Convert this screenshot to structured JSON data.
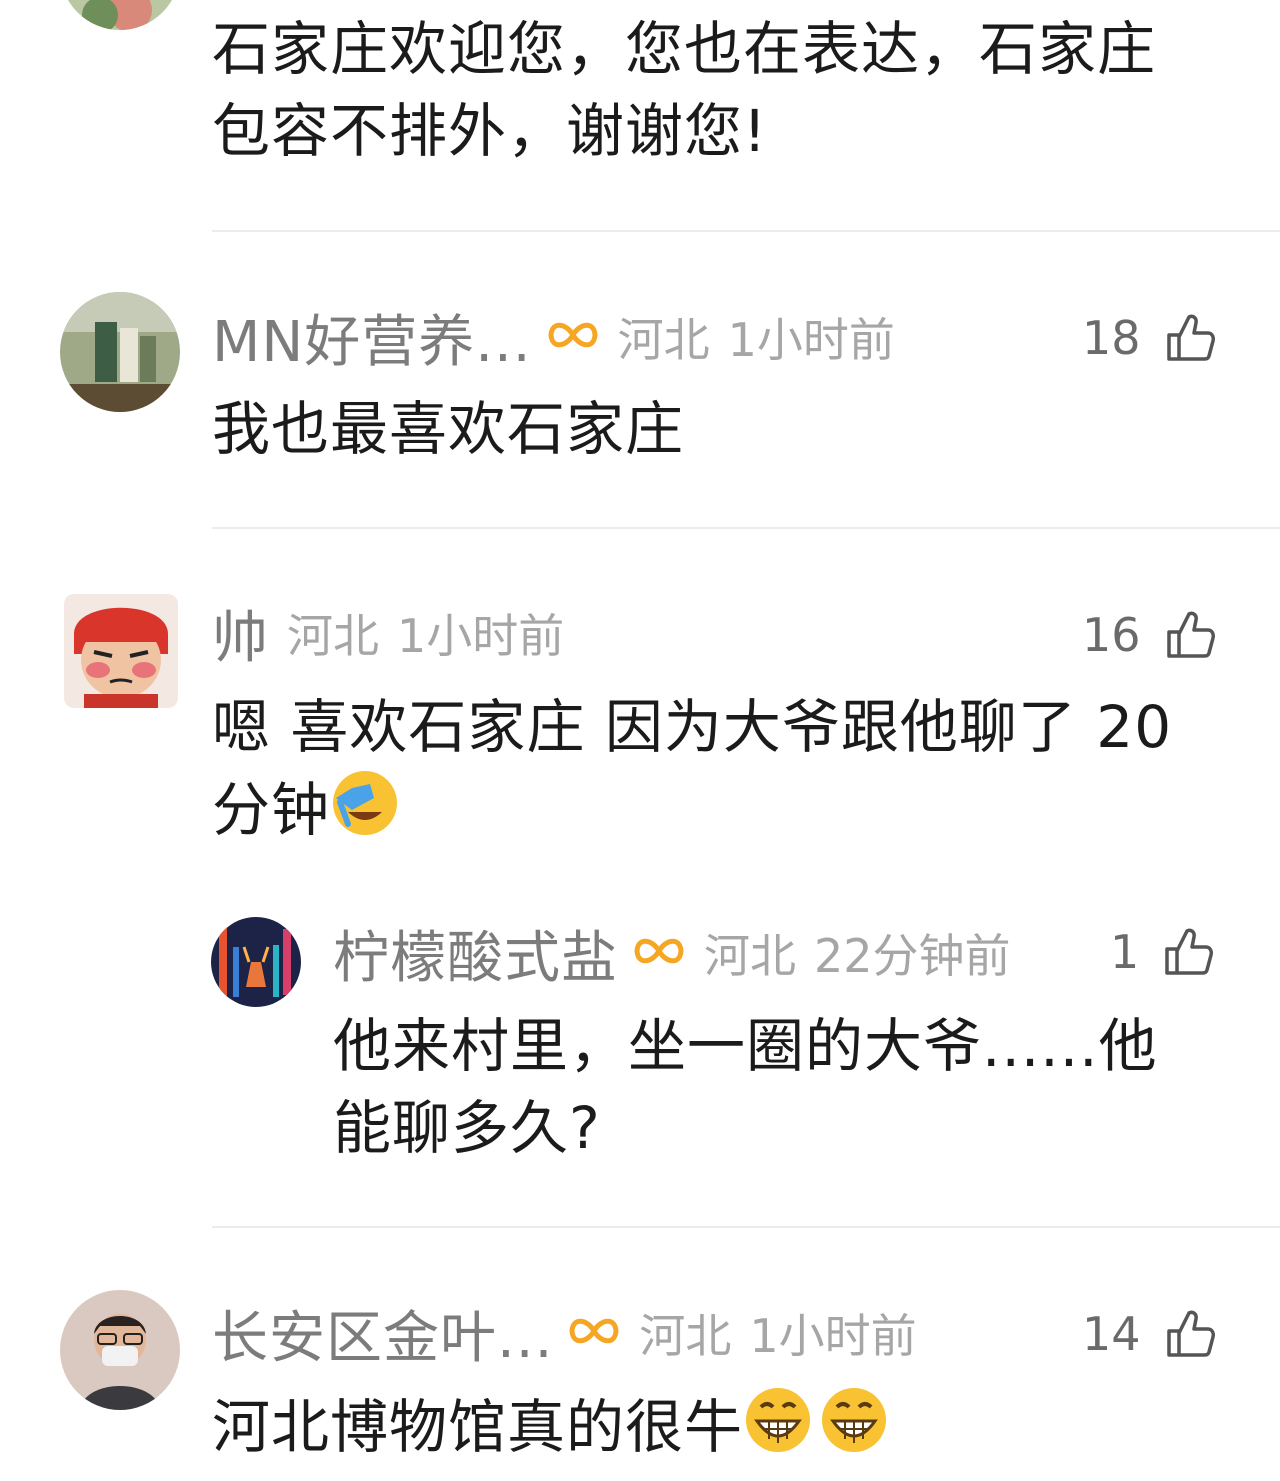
{
  "comments": [
    {
      "text_lines": [
        "石家庄欢迎您，您也在表达，石家庄",
        "包容不排外，谢谢您!"
      ]
    },
    {
      "username": "MN好营养...",
      "location": "河北",
      "time": "1小时前",
      "likes": "18",
      "text": "我也最喜欢石家庄"
    },
    {
      "username": "帅",
      "location": "河北",
      "time": "1小时前",
      "likes": "16",
      "text_line1": "嗯 喜欢石家庄 因为大爷跟他聊了 20",
      "text_line2": "分钟",
      "emoji": "face-palm-laughing"
    },
    {
      "username": "柠檬酸式盐",
      "location": "河北",
      "time": "22分钟前",
      "likes": "1",
      "text_lines": [
        "他来村里，坐一圈的大爷......他",
        "能聊多久?"
      ]
    },
    {
      "username": "长安区金叶...",
      "location": "河北",
      "time": "1小时前",
      "likes": "14",
      "text": "河北博物馆真的很牛",
      "emoji": "grinning-face"
    }
  ],
  "colors": {
    "badge": "#f5a623",
    "username": "#7c7c7c",
    "meta": "#a6a6a6",
    "divider": "#ececec"
  }
}
